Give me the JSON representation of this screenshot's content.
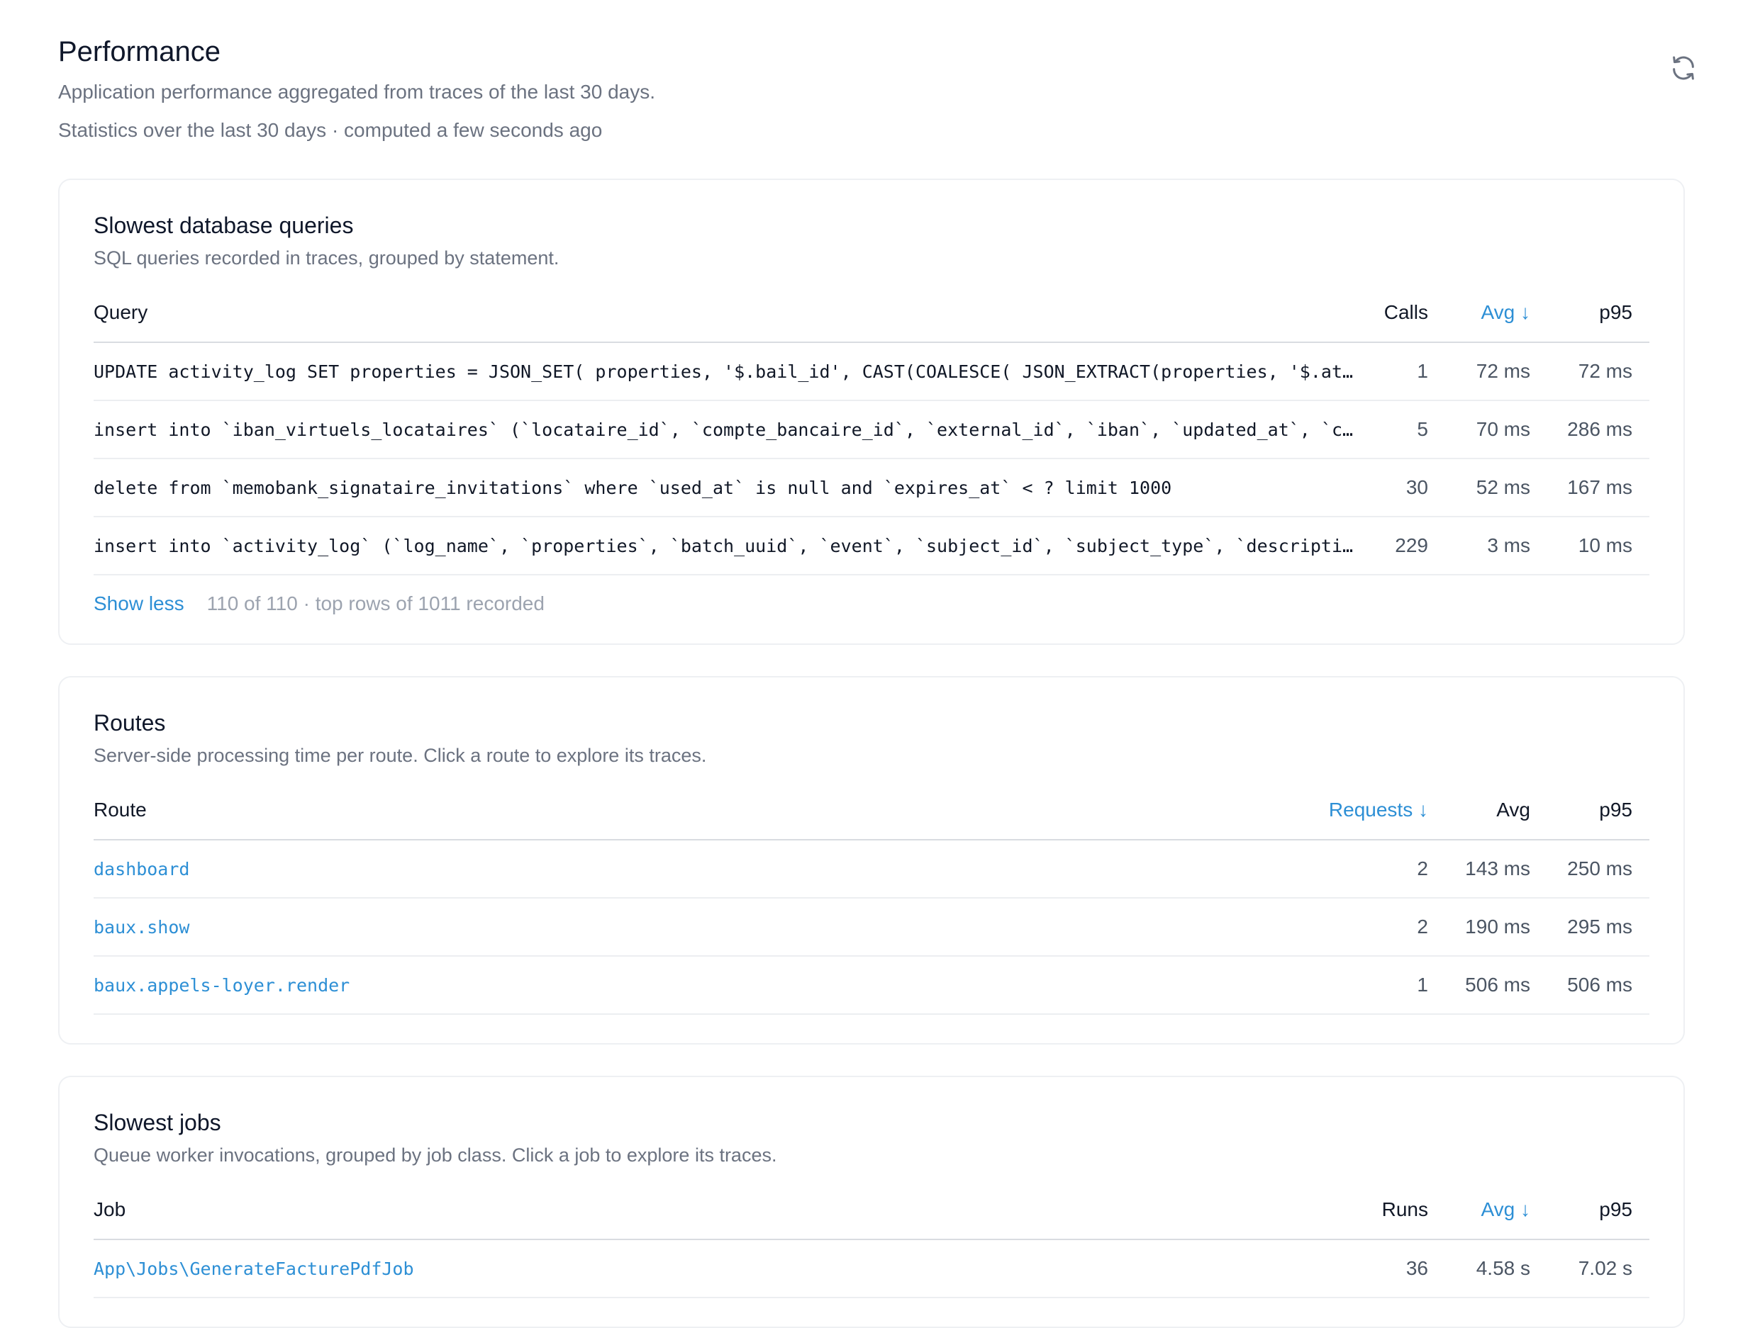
{
  "header": {
    "title": "Performance",
    "subtitle": "Application performance aggregated from traces of the last 30 days.",
    "stats_line": "Statistics over the last 30 days · computed a few seconds ago"
  },
  "queries": {
    "title": "Slowest database queries",
    "description": "SQL queries recorded in traces, grouped by statement.",
    "columns": {
      "query": "Query",
      "calls": "Calls",
      "avg": "Avg ↓",
      "p95": "p95"
    },
    "rows": [
      {
        "query": "UPDATE activity_log SET properties = JSON_SET( properties, '$.bail_id', CAST(COALESCE( JSON_EXTRACT(properties, '$.attribute…",
        "calls": "1",
        "avg": "72 ms",
        "p95": "72 ms"
      },
      {
        "query": "insert into `iban_virtuels_locataires` (`locataire_id`, `compte_bancaire_id`, `external_id`, `iban`, `updated_at`, `created_…",
        "calls": "5",
        "avg": "70 ms",
        "p95": "286 ms"
      },
      {
        "query": "delete from `memobank_signataire_invitations` where `used_at` is null and `expires_at` < ? limit 1000",
        "calls": "30",
        "avg": "52 ms",
        "p95": "167 ms"
      },
      {
        "query": "insert into `activity_log` (`log_name`, `properties`, `batch_uuid`, `event`, `subject_id`, `subject_type`, `description`, `d…",
        "calls": "229",
        "avg": "3 ms",
        "p95": "10 ms"
      }
    ],
    "show_less": "Show less",
    "footer_info": "110 of 110 · top rows of 1011 recorded"
  },
  "routes": {
    "title": "Routes",
    "description": "Server-side processing time per route. Click a route to explore its traces.",
    "columns": {
      "route": "Route",
      "requests": "Requests ↓",
      "avg": "Avg",
      "p95": "p95"
    },
    "rows": [
      {
        "route": "dashboard",
        "requests": "2",
        "avg": "143 ms",
        "p95": "250 ms"
      },
      {
        "route": "baux.show",
        "requests": "2",
        "avg": "190 ms",
        "p95": "295 ms"
      },
      {
        "route": "baux.appels-loyer.render",
        "requests": "1",
        "avg": "506 ms",
        "p95": "506 ms"
      }
    ]
  },
  "jobs": {
    "title": "Slowest jobs",
    "description": "Queue worker invocations, grouped by job class. Click a job to explore its traces.",
    "columns": {
      "job": "Job",
      "runs": "Runs",
      "avg": "Avg ↓",
      "p95": "p95"
    },
    "rows": [
      {
        "job": "App\\Jobs\\GenerateFacturePdfJob",
        "runs": "36",
        "avg": "4.58 s",
        "p95": "7.02 s"
      }
    ]
  },
  "colors": {
    "accent": "#2d8fd5",
    "muted": "#6b7280",
    "border": "#eef0f3"
  },
  "icons": {
    "refresh": "refresh-icon",
    "sort_arrow": "arrow-down"
  }
}
